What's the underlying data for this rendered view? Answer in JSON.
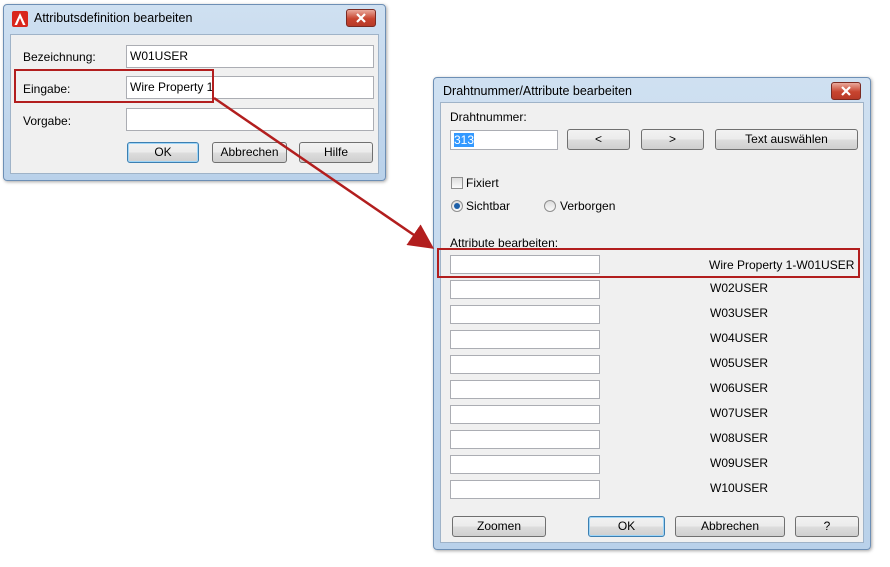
{
  "dialog1": {
    "title": "Attributsdefinition bearbeiten",
    "bezeichnung_label": "Bezeichnung:",
    "bezeichnung_value": "W01USER",
    "eingabe_label": "Eingabe:",
    "eingabe_value": "Wire Property 1",
    "vorgabe_label": "Vorgabe:",
    "vorgabe_value": "",
    "ok": "OK",
    "abbrechen": "Abbrechen",
    "hilfe": "Hilfe"
  },
  "dialog2": {
    "title": "Drahtnummer/Attribute bearbeiten",
    "drahtnummer_label": "Drahtnummer:",
    "drahtnummer_value": "313",
    "prev": "<",
    "next": ">",
    "text_auswaehlen": "Text auswählen",
    "fixiert_label": "Fixiert",
    "fixiert_checked": false,
    "sichtbar_label": "Sichtbar",
    "verborgen_label": "Verborgen",
    "visibility_selected": "Sichtbar",
    "attribute_label": "Attribute bearbeiten:",
    "attributes": [
      {
        "value": "",
        "name": "Wire Property 1-W01USER"
      },
      {
        "value": "",
        "name": "W02USER"
      },
      {
        "value": "",
        "name": "W03USER"
      },
      {
        "value": "",
        "name": "W04USER"
      },
      {
        "value": "",
        "name": "W05USER"
      },
      {
        "value": "",
        "name": "W06USER"
      },
      {
        "value": "",
        "name": "W07USER"
      },
      {
        "value": "",
        "name": "W08USER"
      },
      {
        "value": "",
        "name": "W09USER"
      },
      {
        "value": "",
        "name": "W10USER"
      }
    ],
    "zoomen": "Zoomen",
    "ok": "OK",
    "abbrechen": "Abbrechen",
    "help": "?"
  },
  "colors": {
    "highlight": "#b21e1e",
    "titlebar": "#b9d1ea",
    "client": "#f0f0f0"
  }
}
